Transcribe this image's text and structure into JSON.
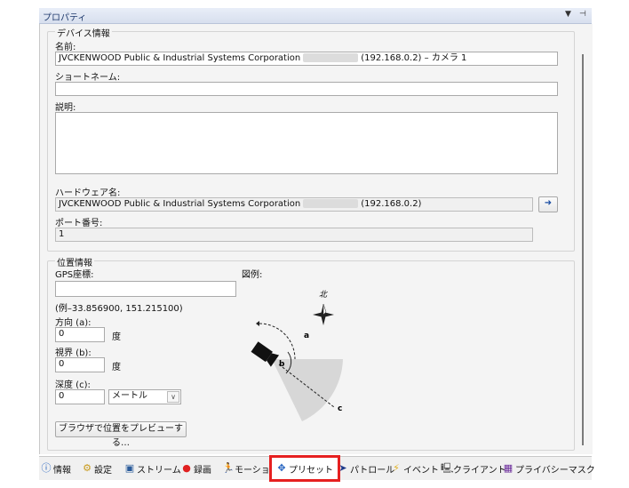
{
  "window": {
    "title": "プロパティ"
  },
  "device": {
    "group_title": "デバイス情報",
    "name_label": "名前:",
    "name_value_left": "JVCKENWOOD Public & Industrial Systems Corporation",
    "name_value_right": "(192.168.0.2) – カメラ 1",
    "short_name_label": "ショートネーム:",
    "short_name_value": "",
    "description_label": "説明:",
    "description_value": "",
    "hardware_name_label": "ハードウェア名:",
    "hardware_value_left": "JVCKENWOOD Public & Industrial Systems Corporation",
    "hardware_value_right": "(192.168.0.2)",
    "port_label": "ポート番号:",
    "port_value": "1"
  },
  "location": {
    "group_title": "位置情報",
    "gps_label": "GPS座標:",
    "gps_value": "",
    "gps_example": "(例–33.856900, 151.215100)",
    "legend_label": "図例:",
    "direction_label": "方向 (a):",
    "direction_value": "0",
    "direction_unit": "度",
    "view_label": "視界 (b):",
    "view_value": "0",
    "view_unit": "度",
    "depth_label": "深度 (c):",
    "depth_value": "0",
    "depth_unit_selected": "メートル",
    "preview_button": "ブラウザで位置をプレビューする…",
    "diagram": {
      "north": "北",
      "a": "a",
      "b": "b",
      "c": "c"
    }
  },
  "tabs": [
    {
      "label": "情報",
      "icon": "info-icon"
    },
    {
      "label": "設定",
      "icon": "gears-icon"
    },
    {
      "label": "ストリーム",
      "icon": "stream-icon"
    },
    {
      "label": "録画",
      "icon": "record-icon"
    },
    {
      "label": "モーショ",
      "icon": "motion-icon"
    },
    {
      "label": "プリセット",
      "icon": "preset-move-icon"
    },
    {
      "label": "パトロール",
      "icon": "patrol-icon"
    },
    {
      "label": "イベント",
      "icon": "event-icon"
    },
    {
      "label": "クライアント",
      "icon": "client-icon"
    },
    {
      "label": "プライバシーマスク",
      "icon": "privacy-mask-icon"
    }
  ],
  "colors": {
    "active_tab_highlight": "#e62020",
    "titlebar_text": "#1f3a6d"
  }
}
